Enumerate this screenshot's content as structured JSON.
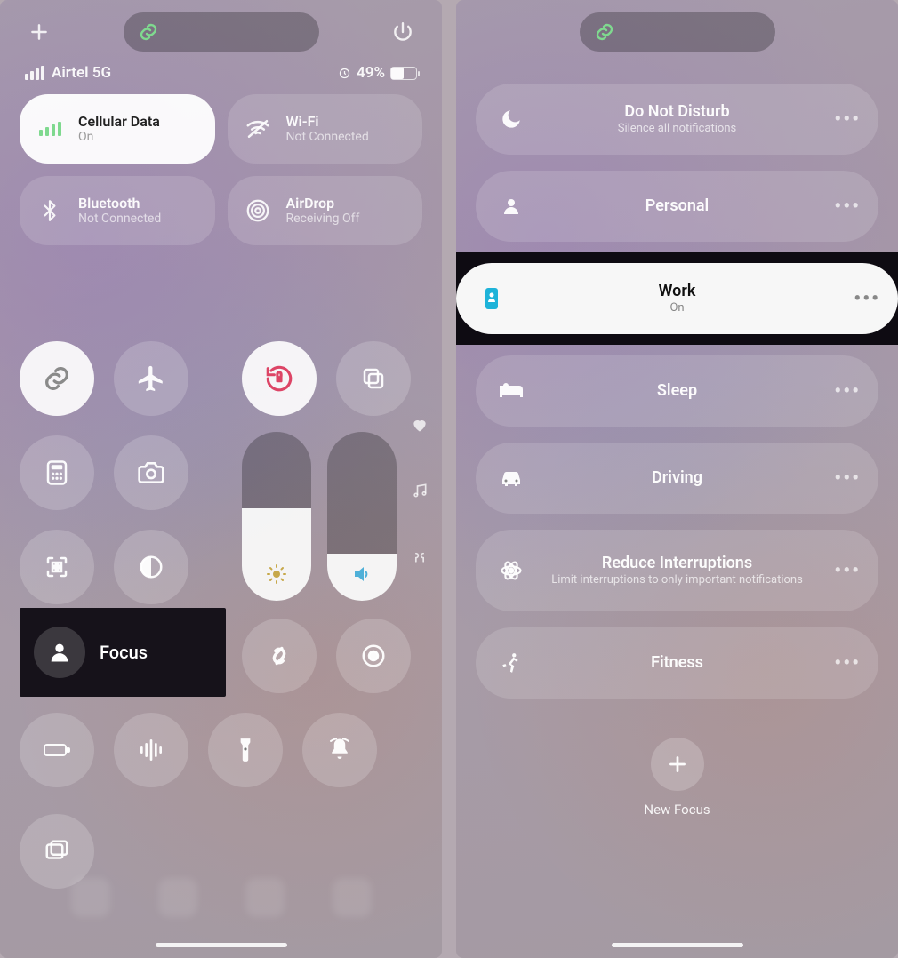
{
  "left": {
    "status": {
      "carrier": "Airtel 5G",
      "battery_pct": "49%"
    },
    "connectivity": {
      "cellular": {
        "title": "Cellular Data",
        "sub": "On"
      },
      "wifi": {
        "title": "Wi-Fi",
        "sub": "Not Connected"
      },
      "bluetooth": {
        "title": "Bluetooth",
        "sub": "Not Connected"
      },
      "airdrop": {
        "title": "AirDrop",
        "sub": "Receiving Off"
      }
    },
    "focus_label": "Focus"
  },
  "right": {
    "items": [
      {
        "title": "Do Not Disturb",
        "sub": "Silence all notifications"
      },
      {
        "title": "Personal",
        "sub": ""
      },
      {
        "title": "Work",
        "sub": "On"
      },
      {
        "title": "Sleep",
        "sub": ""
      },
      {
        "title": "Driving",
        "sub": ""
      },
      {
        "title": "Reduce Interruptions",
        "sub": "Limit interruptions to only important notifications"
      },
      {
        "title": "Fitness",
        "sub": ""
      }
    ],
    "new_focus": "New Focus"
  }
}
